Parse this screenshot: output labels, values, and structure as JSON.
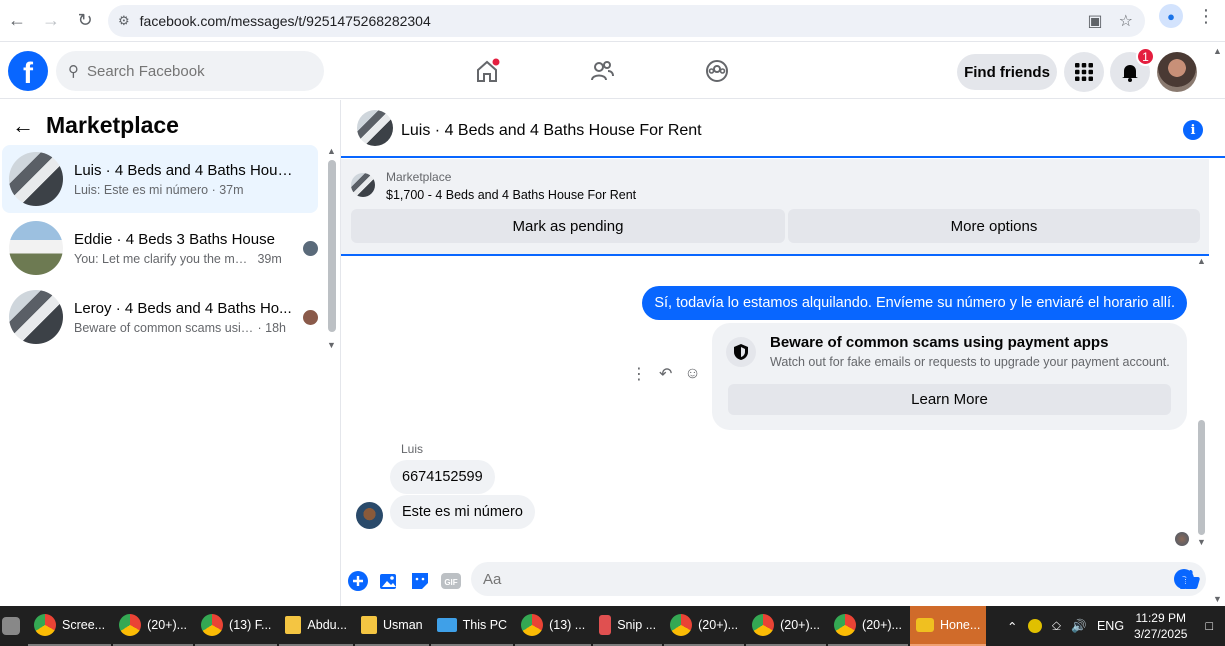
{
  "browser": {
    "url": "facebook.com/messages/t/9251475268282304"
  },
  "header": {
    "search_placeholder": "Search Facebook",
    "find_friends": "Find friends",
    "notification_count": "1"
  },
  "sidebar": {
    "title": "Marketplace",
    "conversations": [
      {
        "name": "Luis · 4 Beds and 4 Baths House ...",
        "snippet": "Luis: Este es mi número",
        "time": "· 37m"
      },
      {
        "name": "Eddie · 4 Beds 3 Baths House",
        "snippet": "You: Let me clarify you the mai...",
        "time": "39m"
      },
      {
        "name": "Leroy · 4 Beds and 4 Baths Ho...",
        "snippet": "Beware of common scams usin...",
        "time": "· 18h"
      }
    ]
  },
  "chat": {
    "title": "Luis · 4 Beds and 4 Baths House For Rent",
    "listing": {
      "label": "Marketplace",
      "title": "$1,700 - 4 Beds and 4 Baths House For Rent",
      "mark_pending": "Mark as pending",
      "more_options": "More options"
    },
    "outgoing": "Sí, todavía lo estamos alquilando. Envíeme su número y le enviaré el horario allí.",
    "scam_card": {
      "title": "Beware of common scams using payment apps",
      "subtitle": "Watch out for fake emails or requests to upgrade your payment account.",
      "button": "Learn More"
    },
    "sender": "Luis",
    "incoming": [
      "6674152599",
      "Este es mi número"
    ],
    "composer_placeholder": "Aa"
  },
  "taskbar": {
    "items": [
      "Scree...",
      "(20+)...",
      "(13) F...",
      "Abdu...",
      "Usman",
      "This PC",
      "(13) ...",
      "Snip ...",
      "(20+)...",
      "(20+)...",
      "(20+)...",
      "Hone..."
    ],
    "lang": "ENG",
    "time": "11:29 PM",
    "date": "3/27/2025"
  },
  "colors": {
    "accent": "#0866ff",
    "active_conv": "#ebf5ff",
    "taskbar": "#202020"
  }
}
